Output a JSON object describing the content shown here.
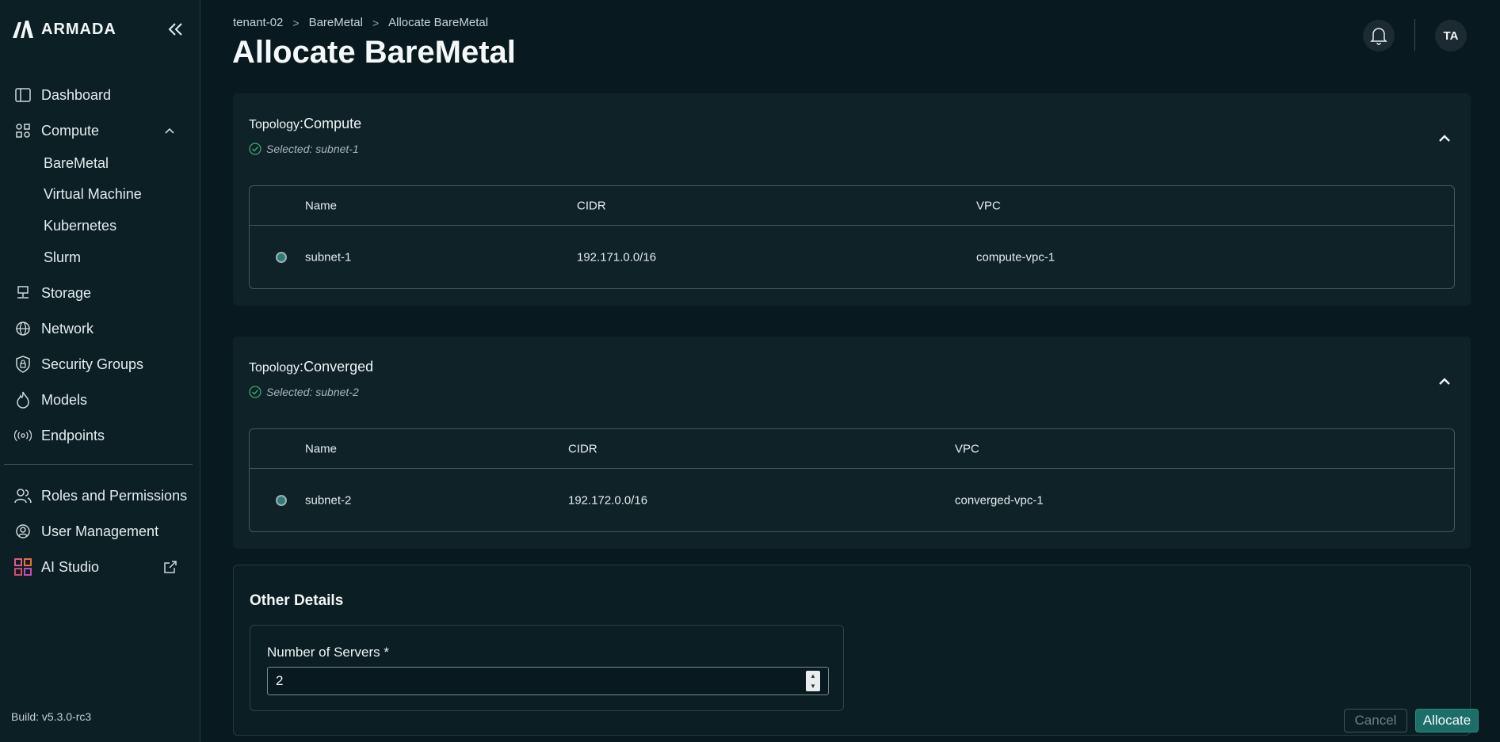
{
  "app": {
    "brand": "ARMADA",
    "build": "Build: v5.3.0-rc3"
  },
  "sidebar": {
    "items": [
      {
        "label": "Dashboard",
        "icon": "dashboard-icon"
      },
      {
        "label": "Compute",
        "icon": "compute-icon"
      },
      {
        "label": "Storage",
        "icon": "storage-icon"
      },
      {
        "label": "Network",
        "icon": "globe-icon"
      },
      {
        "label": "Security Groups",
        "icon": "shield-lock-icon"
      },
      {
        "label": "Models",
        "icon": "flame-icon"
      },
      {
        "label": "Endpoints",
        "icon": "broadcast-icon"
      },
      {
        "label": "Roles and Permissions",
        "icon": "users-icon"
      },
      {
        "label": "User Management",
        "icon": "user-gear-icon"
      },
      {
        "label": "AI Studio",
        "icon": "grid-icon"
      }
    ],
    "compute_sub": [
      "BareMetal",
      "Virtual Machine",
      "Kubernetes",
      "Slurm"
    ]
  },
  "header": {
    "breadcrumb": [
      "tenant-02",
      "BareMetal",
      "Allocate BareMetal"
    ],
    "title": "Allocate BareMetal",
    "avatar": "TA"
  },
  "topologies": [
    {
      "key": "Topology",
      "name": "Compute",
      "selected": "Selected: subnet-1",
      "columns": [
        "Name",
        "CIDR",
        "VPC"
      ],
      "rows": [
        {
          "name": "subnet-1",
          "cidr": "192.171.0.0/16",
          "vpc": "compute-vpc-1"
        }
      ]
    },
    {
      "key": "Topology",
      "name": "Converged",
      "selected": "Selected: subnet-2",
      "columns": [
        "Name",
        "CIDR",
        "VPC"
      ],
      "rows": [
        {
          "name": "subnet-2",
          "cidr": "192.172.0.0/16",
          "vpc": "converged-vpc-1"
        }
      ]
    }
  ],
  "other": {
    "title": "Other Details",
    "servers_label": "Number of Servers *",
    "servers_value": "2"
  },
  "actions": {
    "cancel": "Cancel",
    "allocate": "Allocate"
  },
  "colors": {
    "accent": "#1d6e68",
    "bg": "#081a20",
    "card": "#0e2228",
    "check": "#3fa96a"
  }
}
